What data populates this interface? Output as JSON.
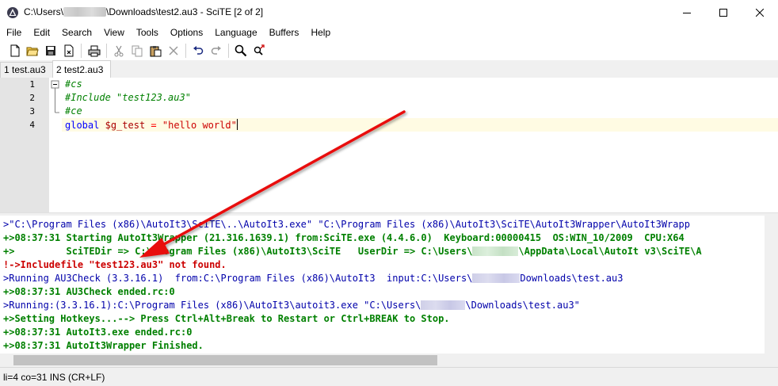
{
  "window": {
    "title_prefix": "C:\\Users\\",
    "title_suffix": "\\Downloads\\test2.au3 - SciTE [2 of 2]"
  },
  "menu": [
    "File",
    "Edit",
    "Search",
    "View",
    "Tools",
    "Options",
    "Language",
    "Buffers",
    "Help"
  ],
  "tabs": [
    {
      "label": "1 test.au3",
      "active": false
    },
    {
      "label": "2 test2.au3",
      "active": true
    }
  ],
  "editor": {
    "line_numbers": [
      "1",
      "2",
      "3",
      "4"
    ],
    "lines": {
      "l1": "#cs",
      "l2": "#Include \"test123.au3\"",
      "l3": "#ce",
      "l4_kw": "global",
      "l4_var": "$g_test",
      "l4_op": "=",
      "l4_str": "\"hello world\""
    }
  },
  "output": {
    "lines": {
      "o1": ">\"C:\\Program Files (x86)\\AutoIt3\\SciTE\\..\\AutoIt3.exe\" \"C:\\Program Files (x86)\\AutoIt3\\SciTE\\AutoIt3Wrapper\\AutoIt3Wrapp",
      "o2": "+>08:37:31 Starting AutoIt3Wrapper (21.316.1639.1) from:SciTE.exe (4.4.6.0)  Keyboard:00000415  OS:WIN_10/2009  CPU:X64",
      "o3a": "+>         SciTEDir => C:\\Program Files (x86)\\AutoIt3\\SciTE   UserDir => C:\\Users\\",
      "o3b": "\\AppData\\Local\\AutoIt v3\\SciTE\\A",
      "o4": "!->Includefile \"test123.au3\" not found.",
      "o5a": ">Running AU3Check (3.3.16.1)  from:C:\\Program Files (x86)\\AutoIt3  input:C:\\Users\\",
      "o5b": "Downloads\\test.au3",
      "o6": "+>08:37:31 AU3Check ended.rc:0",
      "o7a": ">Running:(3.3.16.1):C:\\Program Files (x86)\\AutoIt3\\autoit3.exe \"C:\\Users\\",
      "o7b": "\\Downloads\\test.au3\"",
      "o8": "+>Setting Hotkeys...--> Press Ctrl+Alt+Break to Restart or Ctrl+BREAK to Stop.",
      "o9": "+>08:37:31 AutoIt3.exe ended.rc:0",
      "o10": "+>08:37:31 AutoIt3Wrapper Finished."
    }
  },
  "status": {
    "text": "li=4 co=31 INS (CR+LF)"
  },
  "colors": {
    "comment": "#008000",
    "keyword": "#0000ff",
    "string": "#cc0000",
    "output_blue": "#0000aa",
    "output_green": "#008000",
    "output_error": "#cc0000",
    "annotation_arrow": "#e81010"
  },
  "icons": [
    "app-icon",
    "new-file-icon",
    "open-folder-icon",
    "save-icon",
    "close-file-icon",
    "print-icon",
    "cut-icon",
    "copy-icon",
    "paste-icon",
    "delete-icon",
    "undo-icon",
    "redo-icon",
    "find-icon",
    "replace-icon",
    "minimize-icon",
    "maximize-icon",
    "close-icon"
  ]
}
